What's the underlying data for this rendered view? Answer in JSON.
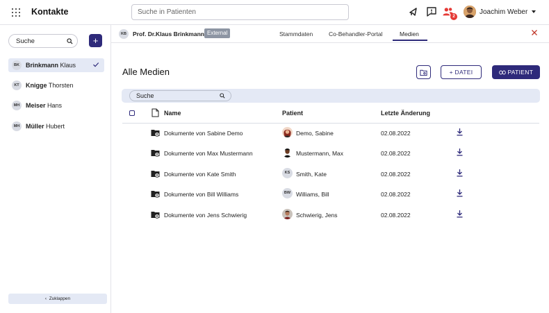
{
  "app": {
    "title": "Kontakte",
    "search_placeholder": "Suche in Patienten",
    "notification_badge": "2",
    "user_name": "Joachim Weber"
  },
  "sidebar": {
    "search_value": "Suche",
    "contacts": [
      {
        "initials": "BK",
        "first_bold": "Brinkmann",
        "rest": " Klaus",
        "active": true
      },
      {
        "initials": "KT",
        "first_bold": "Knigge",
        "rest": " Thorsten",
        "active": false
      },
      {
        "initials": "MH",
        "first_bold": "Meiser",
        "rest": " Hans",
        "active": false
      },
      {
        "initials": "MH",
        "first_bold": "Müller",
        "rest": " Hubert",
        "active": false
      }
    ],
    "collapse_label": "Zuklappen"
  },
  "header": {
    "initials": "KB",
    "name": "Prof. Dr.Klaus Brinkmann",
    "tag": "External",
    "tabs": [
      "Stammdaten",
      "Co-Behandler-Portal",
      "Medien"
    ],
    "active_tab": "Medien"
  },
  "content": {
    "title": "Alle Medien",
    "datei_button": "DATEI",
    "patient_button": "PATIENT",
    "search_value": "Suche",
    "columns": {
      "name": "Name",
      "patient": "Patient",
      "date": "Letzte Änderung"
    },
    "rows": [
      {
        "name": "Dokumente von Sabine Demo",
        "patient": "Demo, Sabine",
        "date": "02.08.2022",
        "avatar": "photo-female"
      },
      {
        "name": "Dokumente von Max Mustermann",
        "patient": "Mustermann, Max",
        "date": "02.08.2022",
        "avatar": "photo-male"
      },
      {
        "name": "Dokumente von Kate Smith",
        "patient": "Smith, Kate",
        "date": "02.08.2022",
        "avatar": "KS"
      },
      {
        "name": "Dokumente von Bill Williams",
        "patient": "Williams, Bill",
        "date": "02.08.2022",
        "avatar": "BW"
      },
      {
        "name": "Dokumente von Jens Schwierig",
        "patient": "Schwierig, Jens",
        "date": "02.08.2022",
        "avatar": "photo-male-2"
      }
    ]
  },
  "colors": {
    "accent": "#2e2a7a",
    "active_bg": "#e4e9f5",
    "badge": "#e53935",
    "tag_bg": "#8d95a3"
  }
}
